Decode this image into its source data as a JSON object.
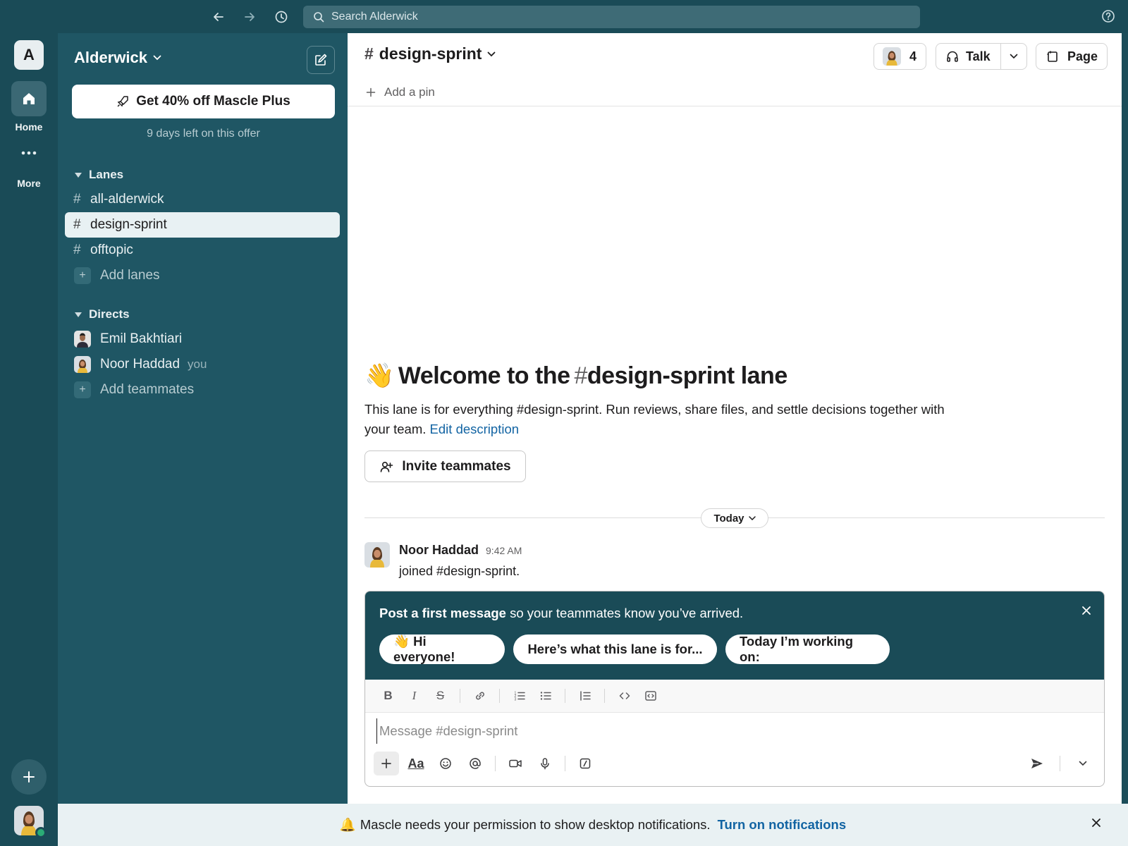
{
  "topbar": {
    "search_placeholder": "Search Alderwick"
  },
  "rail": {
    "workspace_initial": "A",
    "home_label": "Home",
    "more_label": "More"
  },
  "sidebar": {
    "workspace_name": "Alderwick",
    "promo_button": "Get 40% off Mascle Plus",
    "promo_subtext": "9 days left on this offer",
    "lanes_header": "Lanes",
    "lanes": [
      {
        "name": "all-alderwick",
        "active": false
      },
      {
        "name": "design-sprint",
        "active": true
      },
      {
        "name": "offtopic",
        "active": false
      }
    ],
    "add_lanes": "Add lanes",
    "directs_header": "Directs",
    "directs": [
      {
        "name": "Emil Bakhtiari",
        "tag": ""
      },
      {
        "name": "Noor Haddad",
        "tag": "you"
      }
    ],
    "add_teammates": "Add teammates"
  },
  "channel": {
    "hash": "#",
    "name": "design-sprint",
    "member_count": "4",
    "talk_label": "Talk",
    "page_label": "Page",
    "add_pin": "Add a pin"
  },
  "welcome": {
    "emoji": "👋",
    "title_prefix": "Welcome to the",
    "title_hash": "#",
    "title_channel": "design-sprint lane",
    "description": "This lane is for everything #design-sprint. Run reviews, share files, and settle decisions together with your team.",
    "edit_link": "Edit description",
    "invite_button": "Invite teammates"
  },
  "timeline": {
    "day_label": "Today",
    "message": {
      "author": "Noor Haddad",
      "time": "9:42 AM",
      "text": "joined #design-sprint."
    }
  },
  "prompt": {
    "bold": "Post a first message",
    "rest": " so your teammates know you’ve arrived.",
    "chips": [
      "👋 Hi everyone!",
      "Here’s what this lane is for...",
      "Today I’m working on:"
    ]
  },
  "composer": {
    "placeholder": "Message #design-sprint",
    "format_tools": [
      "B",
      "I",
      "S"
    ],
    "aa_label": "Aa"
  },
  "notification": {
    "emoji": "🔔",
    "text": "Mascle needs your permission to show desktop notifications.",
    "link": "Turn on notifications"
  },
  "colors": {
    "sidebar_bg": "#1f5664",
    "rail_bg": "#1a4b57",
    "prompt_bg": "#1a4b57",
    "link": "#1264a3",
    "presence": "#2bac76"
  }
}
